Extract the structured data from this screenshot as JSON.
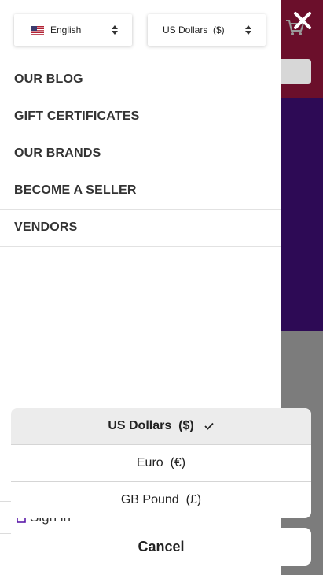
{
  "language_select": {
    "flag_icon": "us-flag-icon",
    "value": "English"
  },
  "currency_select": {
    "value": "US Dollars  ($)"
  },
  "menu": {
    "items": [
      {
        "label": "OUR BLOG"
      },
      {
        "label": "GIFT CERTIFICATES"
      },
      {
        "label": "OUR BRANDS"
      },
      {
        "label": "BECOME A SELLER"
      },
      {
        "label": "VENDORS"
      }
    ]
  },
  "signin": {
    "label": "Sign in"
  },
  "currency_sheet": {
    "options": [
      {
        "label": "US Dollars  ($)",
        "selected": true
      },
      {
        "label": "Euro  (€)",
        "selected": false
      },
      {
        "label": "GB Pound  (£)",
        "selected": false
      }
    ],
    "cancel_label": "Cancel"
  },
  "colors": {
    "header_bg": "#6b0f2b",
    "banner_bg": "#2d0a55",
    "user_icon": "#5b1aa8"
  }
}
